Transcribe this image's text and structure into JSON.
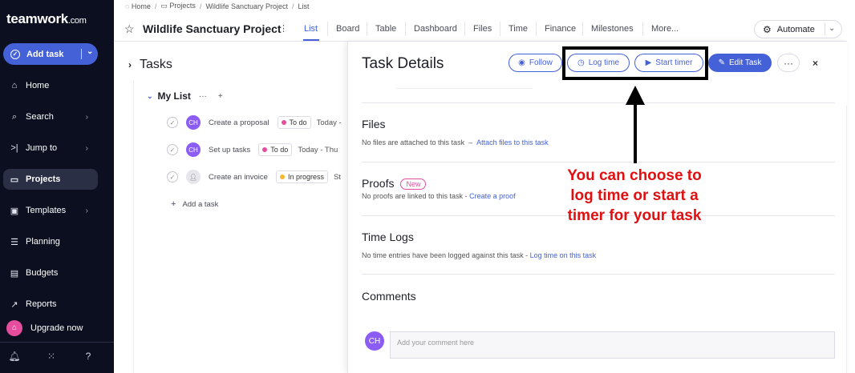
{
  "sidebar": {
    "logo": "teamwork",
    "logo_suffix": ".com",
    "add_task": "Add task",
    "items": [
      {
        "label": "Home",
        "icon": "home-icon",
        "glyph": "⌂"
      },
      {
        "label": "Search",
        "icon": "search-icon",
        "glyph": "⌕"
      },
      {
        "label": "Jump to",
        "icon": "jump-icon",
        "glyph": ">|"
      },
      {
        "label": "Projects",
        "icon": "folder-icon",
        "glyph": "▭"
      },
      {
        "label": "Templates",
        "icon": "templates-icon",
        "glyph": "▣"
      },
      {
        "label": "Planning",
        "icon": "planning-icon",
        "glyph": "☰"
      },
      {
        "label": "Budgets",
        "icon": "budgets-icon",
        "glyph": "▤"
      },
      {
        "label": "Reports",
        "icon": "reports-icon",
        "glyph": "↗"
      }
    ],
    "upgrade": "Upgrade now"
  },
  "breadcrumb": [
    "Home",
    "Projects",
    "Wildlife Sanctuary Project",
    "List"
  ],
  "project": {
    "title": "Wildlife Sanctuary Project",
    "tabs": [
      "List",
      "Board",
      "Table",
      "Dashboard",
      "Files",
      "Time",
      "Finance",
      "Milestones",
      "More..."
    ],
    "automate": "Automate"
  },
  "tasks": {
    "heading": "Tasks",
    "list_name": "My List",
    "rows": [
      {
        "avatar": "CH",
        "name": "Create a proposal",
        "status": "To do",
        "status_color": "#e64d9d",
        "date": "Today -"
      },
      {
        "avatar": "CH",
        "name": "Set up tasks",
        "status": "To do",
        "status_color": "#e64d9d",
        "date": "Today - Thu"
      },
      {
        "avatar": "",
        "name": "Create an invoice",
        "status": "In progress",
        "status_color": "#f5b82e",
        "date": "St"
      }
    ],
    "add_task": "Add a task"
  },
  "details": {
    "title": "Task Details",
    "follow": "Follow",
    "log_time": "Log time",
    "start_timer": "Start timer",
    "edit_task": "Edit Task",
    "more": "···",
    "close": "×",
    "files_title": "Files",
    "files_text": "No files are attached to this task",
    "files_sep": "–",
    "files_link": "Attach files to this task",
    "proofs_title": "Proofs",
    "proofs_badge": "New",
    "proofs_text": "No proofs are linked to this task -",
    "proofs_link": "Create a proof",
    "timelogs_title": "Time Logs",
    "timelogs_text": "No time entries have been logged against this task -",
    "timelogs_link": "Log time on this task",
    "comments_title": "Comments",
    "comment_avatar": "CH",
    "comment_placeholder": "Add your comment here"
  },
  "annotation": {
    "text": "You can choose to log time or start a timer for your task",
    "color": "#e01010"
  },
  "colors": {
    "accent": "#4461d7",
    "sidebar": "#0b0f1f"
  }
}
